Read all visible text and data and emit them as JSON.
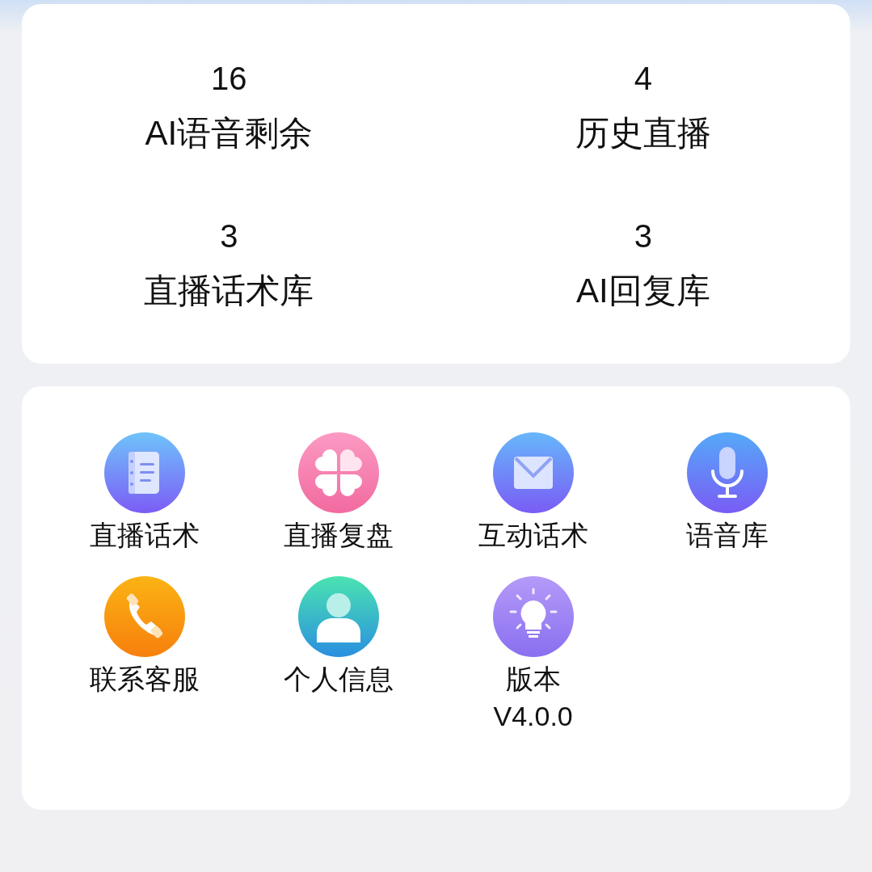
{
  "stats": [
    {
      "value": "16",
      "label": "AI语音剩余"
    },
    {
      "value": "4",
      "label": "历史直播"
    },
    {
      "value": "3",
      "label": "直播话术库"
    },
    {
      "value": "3",
      "label": "AI回复库"
    }
  ],
  "menu": [
    {
      "kind": "notebook",
      "label": "直播话术"
    },
    {
      "kind": "clover",
      "label": "直播复盘"
    },
    {
      "kind": "mail",
      "label": "互动话术"
    },
    {
      "kind": "mic",
      "label": "语音库"
    },
    {
      "kind": "phone",
      "label": "联系客服"
    },
    {
      "kind": "person",
      "label": "个人信息"
    },
    {
      "kind": "bulb",
      "label": "版本",
      "detail": "V4.0.0"
    }
  ]
}
